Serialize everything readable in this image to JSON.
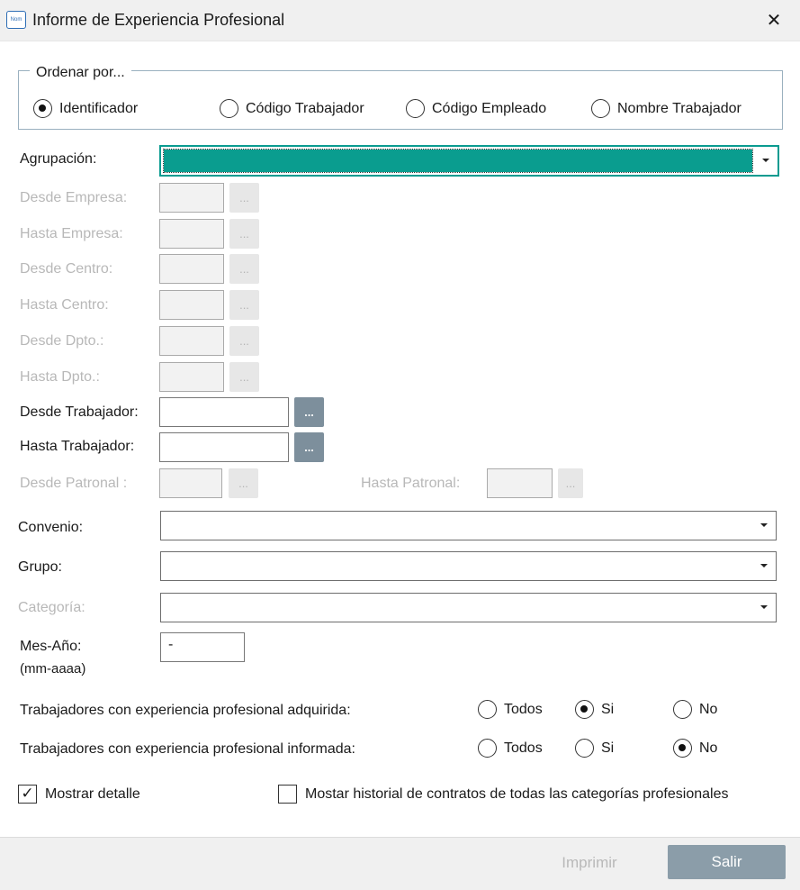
{
  "window": {
    "title": "Informe de Experiencia Profesional",
    "app_icon_text": "Nom",
    "close_glyph": "✕"
  },
  "order": {
    "legend": "Ordenar por...",
    "options": [
      {
        "label": "Identificador",
        "selected": true
      },
      {
        "label": "Código Trabajador",
        "selected": false
      },
      {
        "label": "Código Empleado",
        "selected": false
      },
      {
        "label": "Nombre Trabajador",
        "selected": false
      }
    ]
  },
  "fields": {
    "agrupacion": "Agrupación:",
    "desde_empresa": "Desde Empresa:",
    "hasta_empresa": "Hasta Empresa:",
    "desde_centro": "Desde Centro:",
    "hasta_centro": "Hasta Centro:",
    "desde_dpto": "Desde Dpto.:",
    "hasta_dpto": "Hasta Dpto.:",
    "desde_trabajador": "Desde Trabajador:",
    "hasta_trabajador": "Hasta Trabajador:",
    "desde_patronal": "Desde Patronal :",
    "hasta_patronal": "Hasta Patronal:",
    "convenio": "Convenio:",
    "grupo": "Grupo:",
    "categoria": "Categoría:",
    "mes_anio": "Mes-Año:",
    "mes_anio_hint": "(mm-aaaa)",
    "mes_anio_value": "-",
    "ellipsis": "..."
  },
  "experience": {
    "adquirida_label": "Trabajadores con experiencia profesional adquirida:",
    "informada_label": "Trabajadores con experiencia profesional informada:",
    "todos": "Todos",
    "si": "Si",
    "no": "No",
    "adquirida_selected": "Si",
    "informada_selected": "No"
  },
  "checks": {
    "mostrar_detalle": "Mostrar detalle",
    "mostrar_detalle_checked": true,
    "historial": "Mostar historial de contratos de todas las categorías profesionales",
    "historial_checked": false,
    "check_glyph": "✓"
  },
  "buttons": {
    "imprimir": "Imprimir",
    "salir": "Salir"
  },
  "colors": {
    "accent": "#0a9d8f",
    "button": "#8b9da9"
  }
}
